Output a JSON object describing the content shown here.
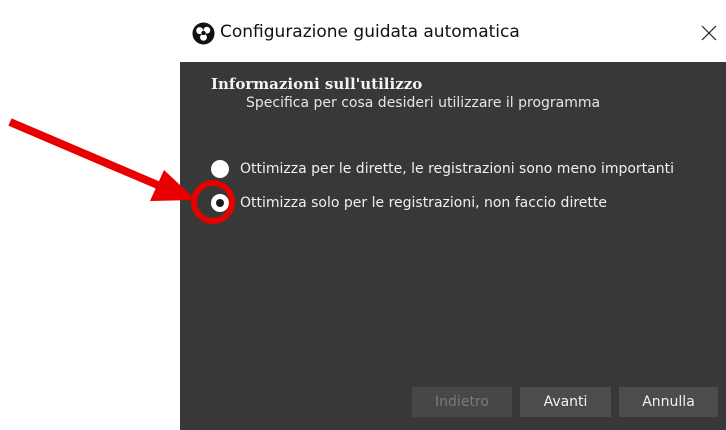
{
  "window": {
    "title": "Configurazione guidata automatica",
    "app_icon": "obs-logo-icon",
    "close_icon": "close-icon"
  },
  "section": {
    "title": "Informazioni sull'utilizzo",
    "subtitle": "Specifica per cosa desideri utilizzare il programma"
  },
  "options": [
    {
      "label": "Ottimizza per le dirette, le registrazioni sono meno importanti",
      "selected": false
    },
    {
      "label": "Ottimizza solo per le registrazioni, non faccio dirette",
      "selected": true
    }
  ],
  "buttons": {
    "back": "Indietro",
    "next": "Avanti",
    "cancel": "Annulla"
  },
  "colors": {
    "panel_bg": "#383838",
    "button_bg": "#4c4c4c",
    "annotation_red": "#e80000"
  },
  "annotations": {
    "arrow_icon": "red-arrow-icon",
    "highlight": "red-circle-highlight"
  }
}
